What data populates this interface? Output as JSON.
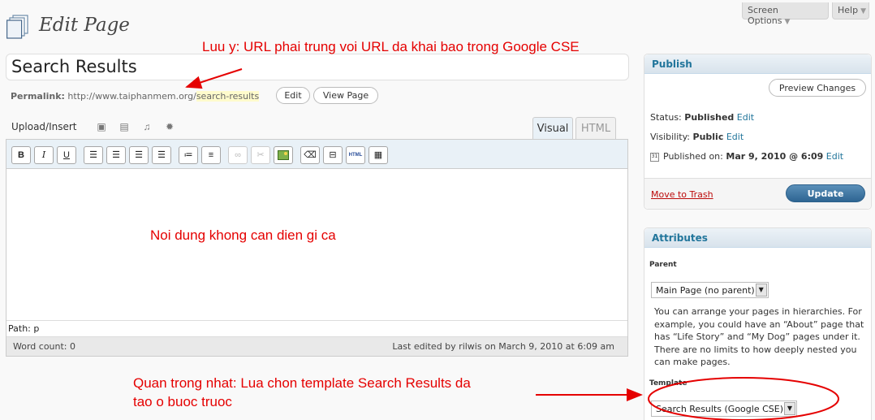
{
  "header": {
    "screen_options": "Screen Options",
    "help": "Help",
    "title": "Edit Page"
  },
  "post": {
    "title": "Search Results",
    "permalink_label": "Permalink:",
    "permalink_base": "http://www.taiphanmem.org/",
    "permalink_slug": "search-results",
    "edit_label": "Edit",
    "view_label": "View Page"
  },
  "editor": {
    "upload_label": "Upload/Insert",
    "tabs": {
      "visual": "Visual",
      "html": "HTML"
    },
    "toolbar": [
      "B",
      "I",
      "U",
      "align-left",
      "align-center",
      "align-right",
      "align-justify",
      "bullet-list",
      "numbered-list",
      "link",
      "unlink",
      "image",
      "eraser",
      "more",
      "html",
      "kitchen-sink"
    ],
    "path": "Path: p",
    "word_count": "Word count: 0",
    "last_edited": "Last edited by rilwis on March 9, 2010 at 6:09 am"
  },
  "publish": {
    "title": "Publish",
    "preview": "Preview Changes",
    "status_label": "Status:",
    "status_value": "Published",
    "visibility_label": "Visibility:",
    "visibility_value": "Public",
    "published_label": "Published on:",
    "published_value": "Mar 9, 2010 @ 6:09",
    "edit_link": "Edit",
    "trash": "Move to Trash",
    "update": "Update"
  },
  "attributes": {
    "title": "Attributes",
    "parent_label": "Parent",
    "parent_value": "Main Page (no parent)",
    "help_text": "You can arrange your pages in hierarchies. For example, you could have an “About” page that has “Life Story” and “My Dog” pages under it. There are no limits to how deeply nested you can make pages.",
    "template_label": "Template",
    "template_value": "Search Results (Google CSE)"
  },
  "annotations": {
    "note1": "Luu y: URL phai trung voi URL da khai bao trong Google CSE",
    "note2": "Noi dung khong can dien gi ca",
    "note3_line1": "Quan trong nhat: Lua chon template Search Results da",
    "note3_line2": "tao o buoc truoc"
  },
  "colors": {
    "link": "#21759b",
    "annotation": "#e50000",
    "update_button": "#2e6592",
    "trash": "#bc0b0b"
  }
}
